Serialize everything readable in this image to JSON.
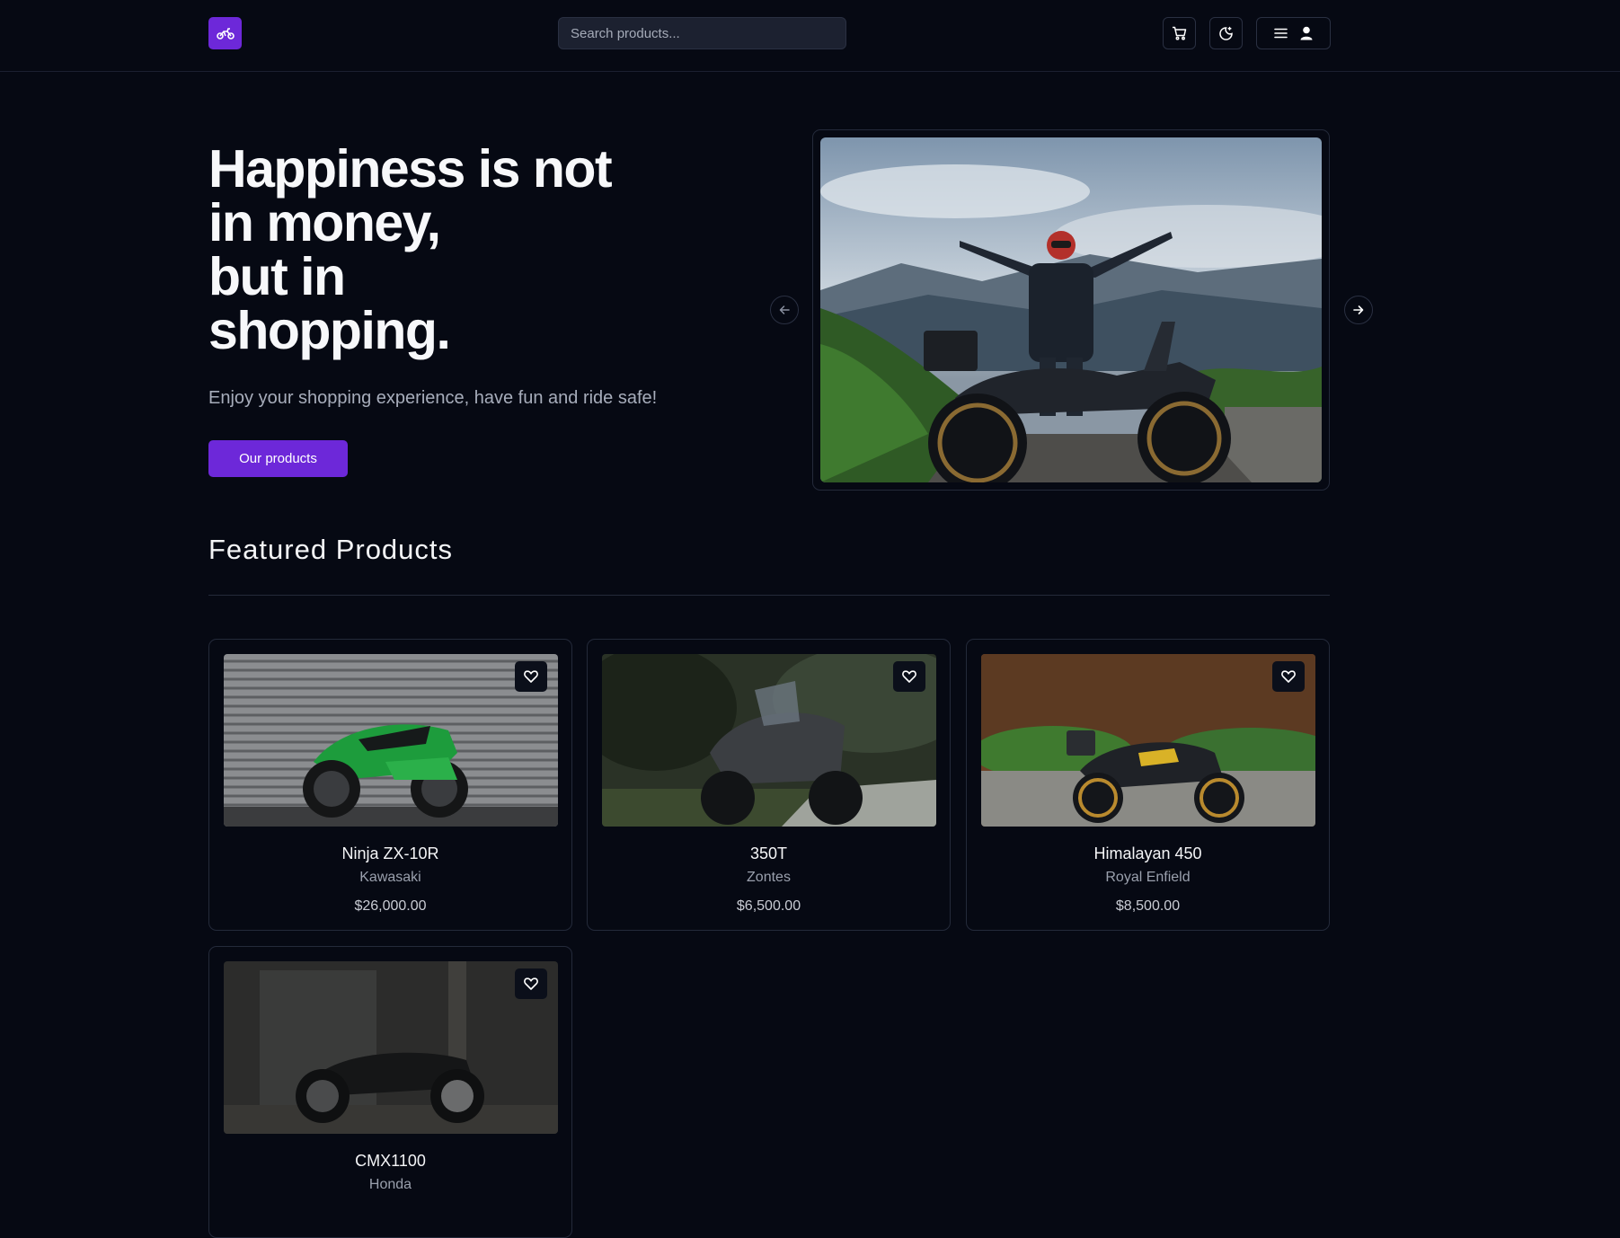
{
  "header": {
    "search_placeholder": "Search products..."
  },
  "hero": {
    "title_lines": [
      "Happiness is not",
      "in money,",
      "but in",
      "shopping."
    ],
    "subtitle": "Enjoy your shopping experience, have fun and ride safe!",
    "cta_label": "Our products"
  },
  "featured": {
    "title": "Featured Products",
    "products": [
      {
        "name": "Ninja ZX-10R",
        "brand": "Kawasaki",
        "price": "$26,000.00"
      },
      {
        "name": "350T",
        "brand": "Zontes",
        "price": "$6,500.00"
      },
      {
        "name": "Himalayan 450",
        "brand": "Royal Enfield",
        "price": "$8,500.00"
      },
      {
        "name": "CMX1100",
        "brand": "Honda",
        "price": ""
      }
    ]
  },
  "colors": {
    "accent": "#6d28d9",
    "background": "#060913",
    "border": "#242a3a"
  },
  "icons": {
    "logo": "motorcycle-icon",
    "cart": "cart-icon",
    "theme": "moon-sparkle-icon",
    "menu": "menu-icon",
    "user": "user-icon",
    "prev": "arrow-left-icon",
    "next": "arrow-right-icon",
    "favorite": "heart-icon"
  }
}
